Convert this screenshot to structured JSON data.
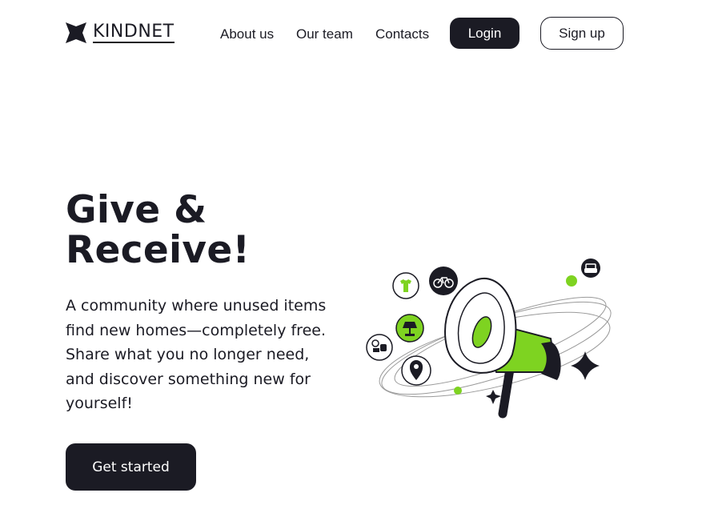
{
  "brand": {
    "name": "KINDNET"
  },
  "nav": {
    "items": [
      {
        "label": "About us"
      },
      {
        "label": "Our team"
      },
      {
        "label": "Contacts"
      }
    ],
    "login_label": "Login",
    "signup_label": "Sign up"
  },
  "hero": {
    "title_line1": "Give &",
    "title_line2": "Receive!",
    "description": "A community where unused items find new homes—completely free. Share what you no longer need, and discover something new for yourself!",
    "cta_label": "Get started"
  },
  "colors": {
    "dark": "#1b1b24",
    "accent_green": "#7ed321",
    "background": "#ffffff"
  },
  "illustration": {
    "icons": [
      "megaphone-icon",
      "shirt-icon",
      "bicycle-icon",
      "lamp-icon",
      "gamepad-icon",
      "location-pin-icon",
      "sofa-icon",
      "sparkle-icon"
    ]
  }
}
